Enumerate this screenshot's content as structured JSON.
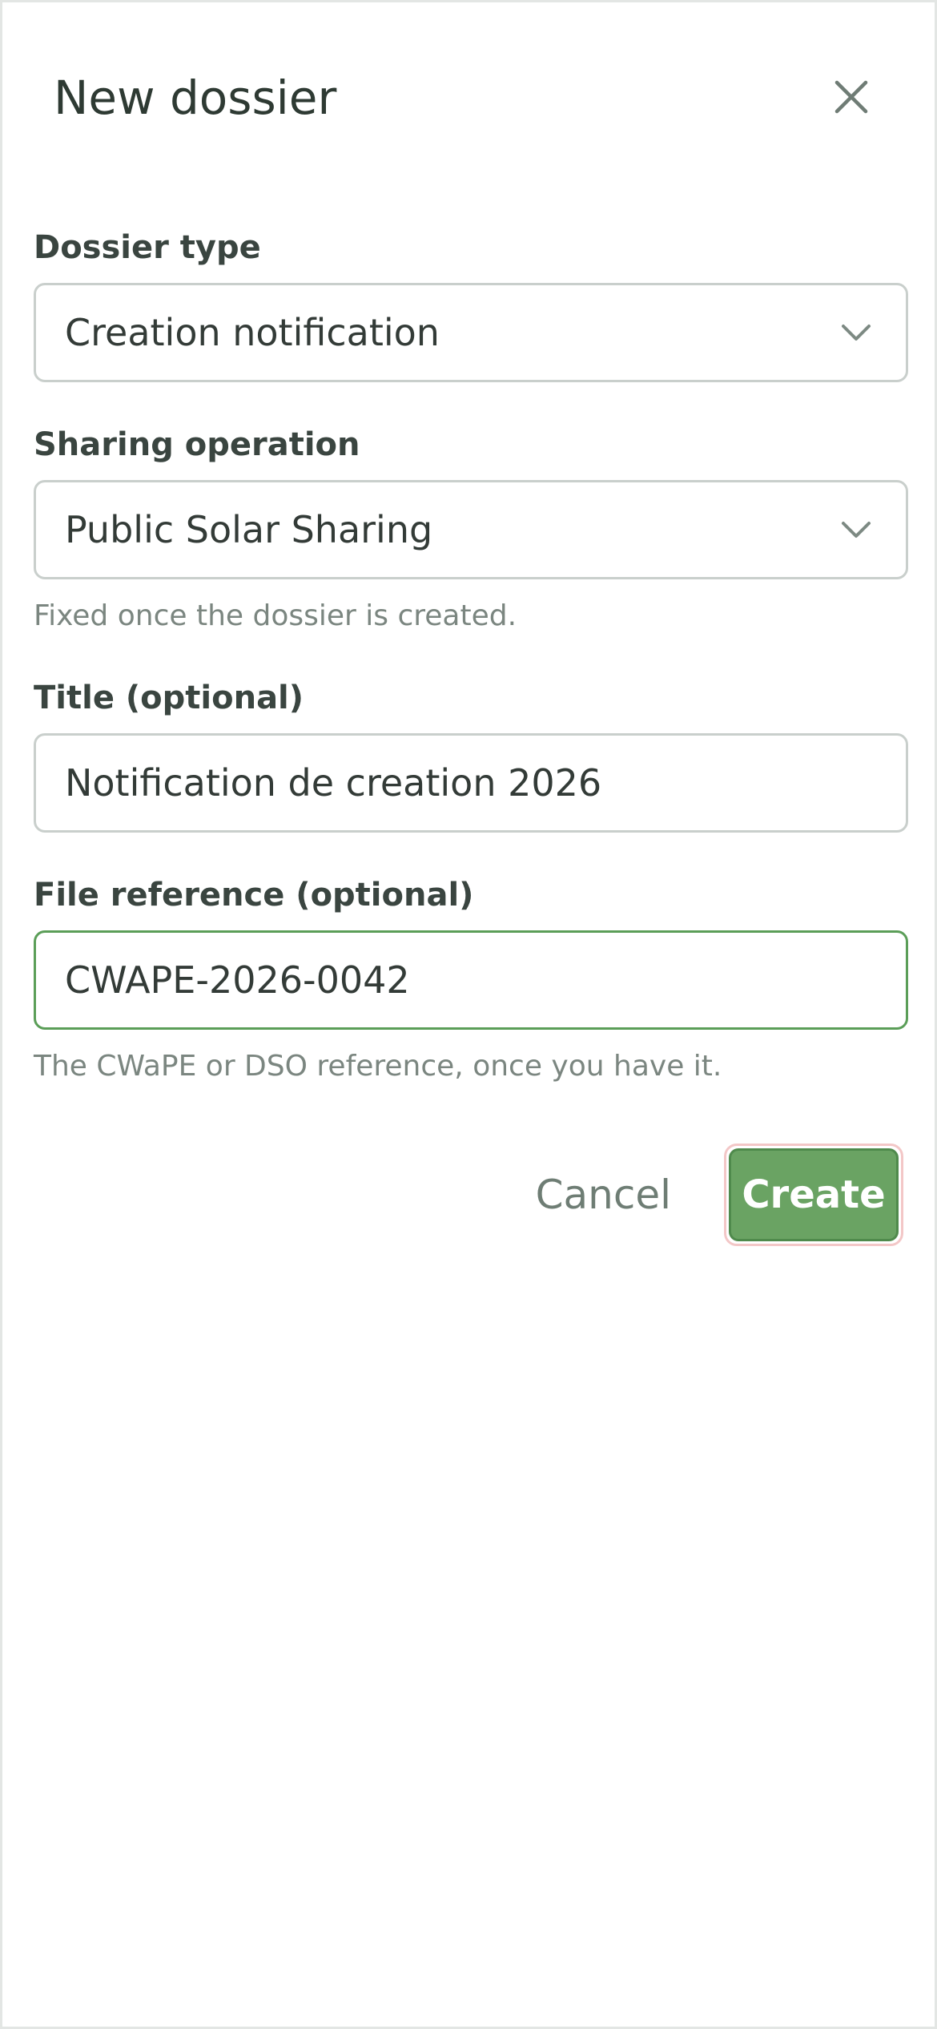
{
  "dialog": {
    "title": "New dossier",
    "close_icon": "close-icon"
  },
  "fields": {
    "dossier_type": {
      "label": "Dossier type",
      "value": "Creation notification",
      "icon": "chevron-down-icon"
    },
    "sharing_operation": {
      "label": "Sharing operation",
      "value": "Public Solar Sharing",
      "help": "Fixed once the dossier is created.",
      "icon": "chevron-down-icon"
    },
    "title": {
      "label": "Title (optional)",
      "value": "Notification de creation 2026"
    },
    "file_reference": {
      "label": "File reference (optional)",
      "value": "CWAPE-2026-0042",
      "help": "The CWaPE or DSO reference, once you have it."
    }
  },
  "actions": {
    "cancel_label": "Cancel",
    "create_label": "Create"
  },
  "colors": {
    "accent": "#6aa363",
    "focus_border": "#5b9e58",
    "text": "#2f3a34",
    "muted": "#7b8680"
  }
}
